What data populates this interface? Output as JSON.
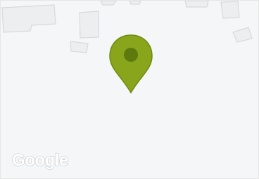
{
  "map": {
    "attribution": "Google",
    "colors": {
      "background": "#f5f6f8",
      "building_fill": "#eceef0",
      "building_stroke": "#d7d9dc",
      "pin_fill": "#88a51b",
      "pin_stroke": "#6f8a10",
      "pin_dot": "#5e7a0f"
    },
    "icons": [
      "map-pin-icon",
      "google-logo"
    ]
  }
}
